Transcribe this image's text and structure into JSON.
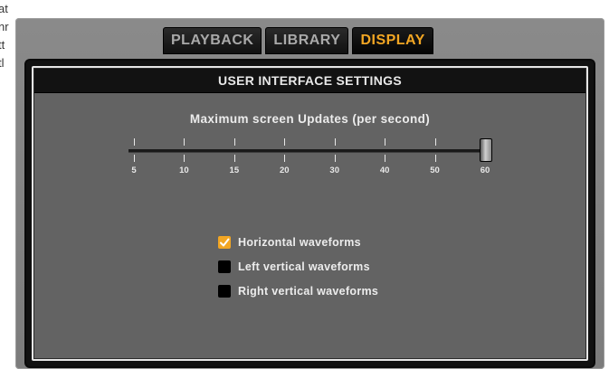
{
  "background_text": [
    "at",
    "nr",
    "tt",
    "tl"
  ],
  "tabs": [
    {
      "label": "PLAYBACK",
      "active": false
    },
    {
      "label": "LIBRARY",
      "active": false
    },
    {
      "label": "DISPLAY",
      "active": true
    }
  ],
  "section": {
    "title": "USER INTERFACE SETTINGS"
  },
  "slider": {
    "label": "Maximum screen Updates (per second)",
    "ticks": [
      "5",
      "10",
      "15",
      "20",
      "30",
      "40",
      "50",
      "60"
    ],
    "value": "60"
  },
  "checkboxes": [
    {
      "label": "Horizontal waveforms",
      "checked": true
    },
    {
      "label": "Left vertical waveforms",
      "checked": false
    },
    {
      "label": "Right vertical waveforms",
      "checked": false
    }
  ],
  "colors": {
    "accent": "#f2a623",
    "panel": "#636363",
    "header": "#121212"
  }
}
